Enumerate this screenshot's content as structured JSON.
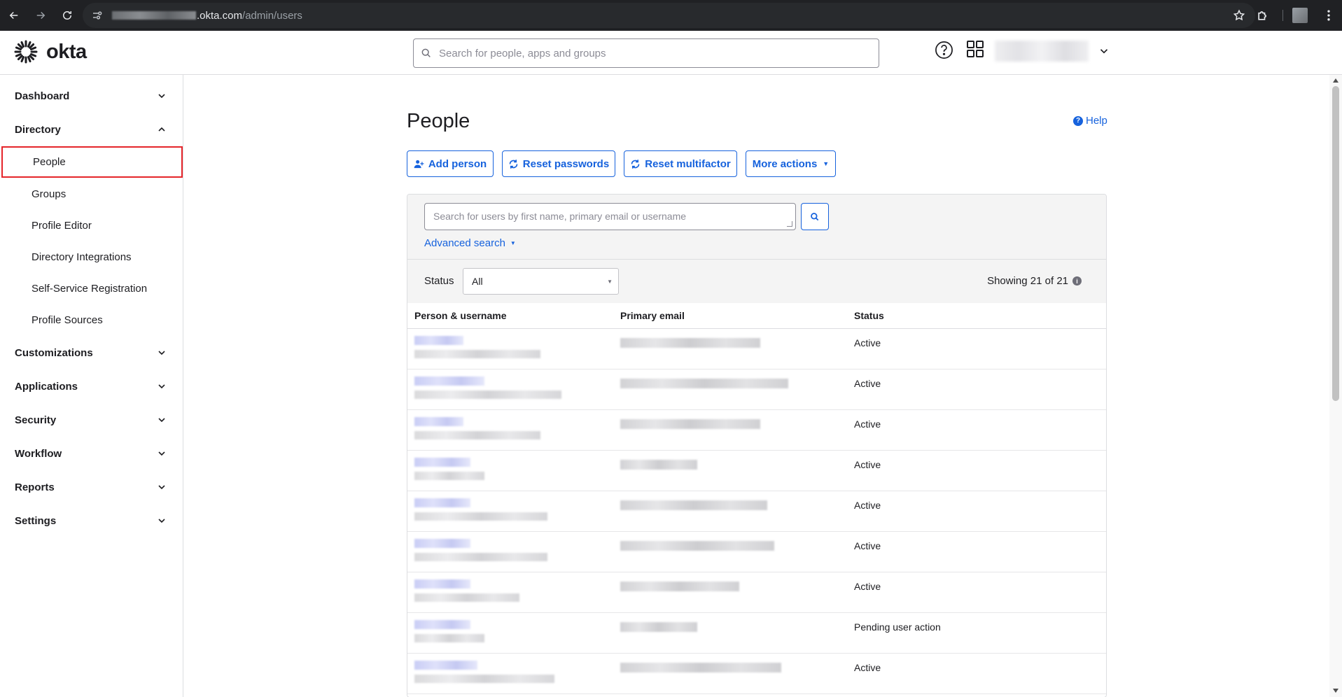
{
  "browser": {
    "url_domain": ".okta.com",
    "url_path": "/admin/users"
  },
  "header": {
    "logo_text": "okta",
    "search_placeholder": "Search for people, apps and groups"
  },
  "sidebar": {
    "sections": [
      {
        "label": "Dashboard",
        "expanded": false
      },
      {
        "label": "Directory",
        "expanded": true
      },
      {
        "label": "Customizations",
        "expanded": false
      },
      {
        "label": "Applications",
        "expanded": false
      },
      {
        "label": "Security",
        "expanded": false
      },
      {
        "label": "Workflow",
        "expanded": false
      },
      {
        "label": "Reports",
        "expanded": false
      },
      {
        "label": "Settings",
        "expanded": false
      }
    ],
    "directory_items": [
      {
        "label": "People",
        "active": true
      },
      {
        "label": "Groups"
      },
      {
        "label": "Profile Editor"
      },
      {
        "label": "Directory Integrations"
      },
      {
        "label": "Self-Service Registration"
      },
      {
        "label": "Profile Sources"
      }
    ],
    "highlight_color": "#e5252a"
  },
  "main": {
    "title": "People",
    "help_label": "Help",
    "actions": {
      "add_person": "Add person",
      "reset_passwords": "Reset passwords",
      "reset_multifactor": "Reset multifactor",
      "more_actions": "More actions"
    },
    "user_search_placeholder": "Search for users by first name, primary email or username",
    "advanced_search": "Advanced search",
    "status_filter_label": "Status",
    "status_filter_value": "All",
    "showing": "Showing 21 of 21",
    "columns": [
      "Person & username",
      "Primary email",
      "Status"
    ],
    "rows": [
      {
        "status": "Active"
      },
      {
        "status": "Active"
      },
      {
        "status": "Active"
      },
      {
        "status": "Active"
      },
      {
        "status": "Active"
      },
      {
        "status": "Active"
      },
      {
        "status": "Active"
      },
      {
        "status": "Pending user action"
      },
      {
        "status": "Active"
      }
    ]
  },
  "colors": {
    "accent": "#1662dd",
    "chrome_bg": "#202124",
    "text": "#1d1d21"
  }
}
